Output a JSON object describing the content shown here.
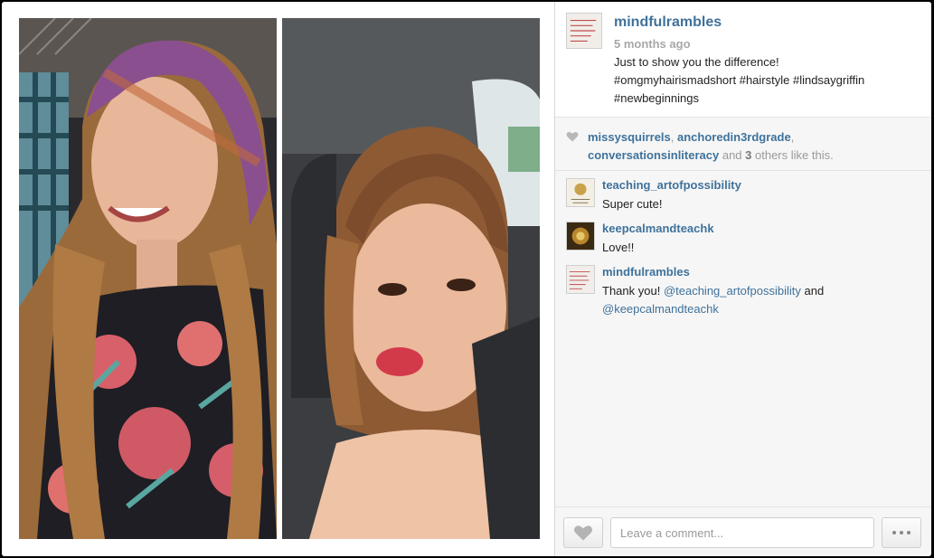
{
  "post": {
    "username": "mindfulrambles",
    "timestamp": "5 months ago",
    "caption_lines": [
      "Just to show you the difference!",
      "#omgmyhairismadshort #hairstyle #lindsaygriffin",
      "#newbeginnings"
    ]
  },
  "likes": {
    "users": [
      "missysquirrels",
      "anchoredin3rdgrade",
      "conversationsinliteracy"
    ],
    "sep1": ", ",
    "sep2": ",",
    "and_text": " and ",
    "others_count": "3",
    "others_suffix": " others like this."
  },
  "comments": [
    {
      "username": "teaching_artofpossibility",
      "text": "Super cute!"
    },
    {
      "username": "keepcalmandteachk",
      "text": "Love!!"
    },
    {
      "username": "mindfulrambles",
      "text_before": "Thank you! ",
      "mention1": "@teaching_artofpossibility",
      "text_mid": " and",
      "mention2": "@keepcalmandteachk"
    }
  ],
  "input": {
    "placeholder": "Leave a comment..."
  },
  "colors": {
    "link": "#3f729b",
    "muted": "#a8a8a8"
  },
  "icons": {
    "like_button": "heart-icon",
    "more_button": "ellipsis-icon"
  }
}
